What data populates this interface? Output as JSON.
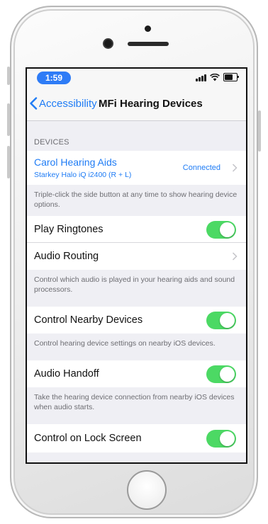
{
  "status_bar": {
    "time": "1:59"
  },
  "nav": {
    "back_label": "Accessibility",
    "title": "MFi Hearing Devices"
  },
  "devices": {
    "header": "DEVICES",
    "device_name": "Carol Hearing Aids",
    "device_model": "Starkey Halo iQ i2400 (R + L)",
    "device_status": "Connected",
    "footer": "Triple-click the side button at any time to show hearing device options."
  },
  "settings": {
    "play_ringtones": {
      "label": "Play Ringtones",
      "enabled": true
    },
    "audio_routing": {
      "label": "Audio Routing"
    },
    "audio_routing_footer": "Control which audio is played in your hearing aids and sound processors.",
    "control_nearby": {
      "label": "Control Nearby Devices",
      "enabled": true
    },
    "control_nearby_footer": "Control hearing device settings on nearby iOS devices.",
    "audio_handoff": {
      "label": "Audio Handoff",
      "enabled": true
    },
    "audio_handoff_footer": "Take the hearing device connection from nearby iOS devices when audio starts.",
    "lock_screen": {
      "label": "Control on Lock Screen",
      "enabled": true
    }
  },
  "colors": {
    "accent": "#1f7cf5",
    "toggle_on": "#4cd964",
    "background": "#efeff4"
  }
}
